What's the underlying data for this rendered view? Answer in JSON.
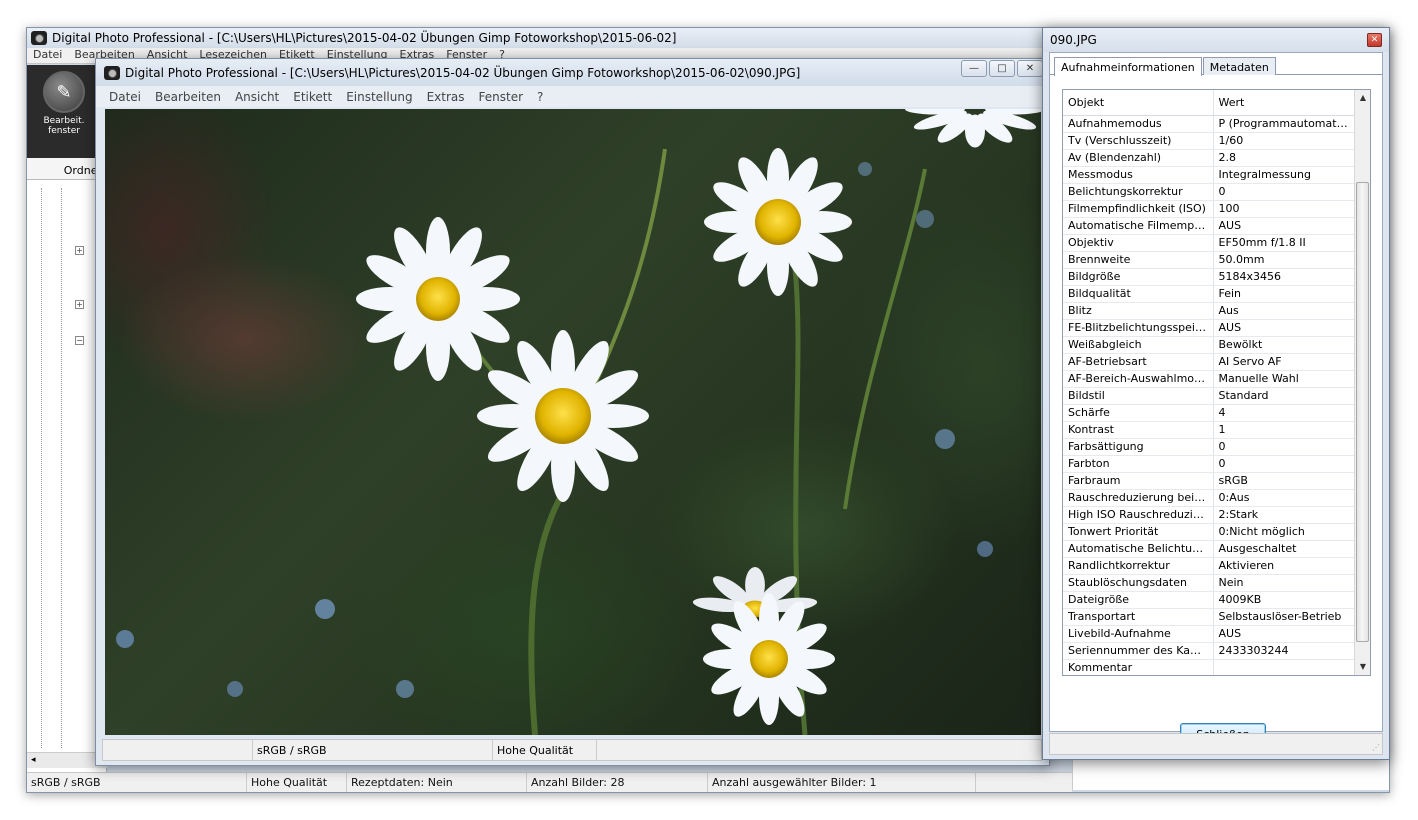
{
  "back_window": {
    "title": "Digital Photo Professional - [C:\\Users\\HL\\Pictures\\2015-04-02 Übungen  Gimp Fotoworkshop\\2015-06-02]",
    "menu": [
      "Datei",
      "Bearbeiten",
      "Ansicht",
      "Lesezeichen",
      "Etikett",
      "Einstellung",
      "Extras",
      "Fenster",
      "?"
    ],
    "edit_button_label": "Bearbeit. fenster",
    "folder_tab": "Ordner",
    "status": {
      "color_space": "sRGB / sRGB",
      "quality": "Hohe Qualität",
      "recipe": "Rezeptdaten: Nein",
      "count": "Anzahl Bilder: 28",
      "selected": "Anzahl ausgewählter Bilder: 1"
    }
  },
  "viewer": {
    "title": "Digital Photo Professional - [C:\\Users\\HL\\Pictures\\2015-04-02 Übungen  Gimp Fotoworkshop\\2015-06-02\\090.JPG]",
    "menu": [
      "Datei",
      "Bearbeiten",
      "Ansicht",
      "Etikett",
      "Einstellung",
      "Extras",
      "Fenster",
      "?"
    ],
    "status_color": "sRGB / sRGB",
    "status_quality": "Hohe Qualität"
  },
  "dialog": {
    "title": "090.JPG",
    "tabs": [
      "Aufnahmeinformationen",
      "Metadaten"
    ],
    "columns": [
      "Objekt",
      "Wert"
    ],
    "rows": [
      [
        "Aufnahmemodus",
        "P (Programmautomatik)"
      ],
      [
        "Tv (Verschlusszeit)",
        "1/60"
      ],
      [
        "Av (Blendenzahl)",
        "2.8"
      ],
      [
        "Messmodus",
        "Integralmessung"
      ],
      [
        "Belichtungskorrektur",
        "0"
      ],
      [
        "Filmempfindlichkeit (ISO)",
        "100"
      ],
      [
        "Automatische Filmempfindli...",
        "AUS"
      ],
      [
        "Objektiv",
        "EF50mm f/1.8 II"
      ],
      [
        "Brennweite",
        "50.0mm"
      ],
      [
        "Bildgröße",
        "5184x3456"
      ],
      [
        "Bildqualität",
        "Fein"
      ],
      [
        "Blitz",
        "Aus"
      ],
      [
        "FE-Blitzbelichtungsspeicher...",
        "AUS"
      ],
      [
        "Weißabgleich",
        "Bewölkt"
      ],
      [
        "AF-Betriebsart",
        "AI Servo AF"
      ],
      [
        "AF-Bereich-Auswahlmodus",
        "Manuelle  Wahl"
      ],
      [
        "Bildstil",
        "Standard"
      ],
      [
        "Schärfe",
        "4"
      ],
      [
        "Kontrast",
        "1"
      ],
      [
        "Farbsättigung",
        "0"
      ],
      [
        "Farbton",
        "0"
      ],
      [
        "Farbraum",
        "sRGB"
      ],
      [
        "Rauschreduzierung bei Lan...",
        "0:Aus"
      ],
      [
        "High ISO Rauschreduzierung",
        "2:Stark"
      ],
      [
        "Tonwert Priorität",
        "0:Nicht möglich"
      ],
      [
        "Automatische Belichtungso...",
        "Ausgeschaltet"
      ],
      [
        "Randlichtkorrektur",
        "Aktivieren"
      ],
      [
        "Staublöschungsdaten",
        "Nein"
      ],
      [
        "Dateigröße",
        "4009KB"
      ],
      [
        "Transportart",
        "Selbstauslöser-Betrieb"
      ],
      [
        "Livebild-Aufnahme",
        "AUS"
      ],
      [
        "Seriennummer des Kamera...",
        "2433303244"
      ],
      [
        "Kommentar",
        ""
      ]
    ],
    "close_label": "Schließen"
  }
}
